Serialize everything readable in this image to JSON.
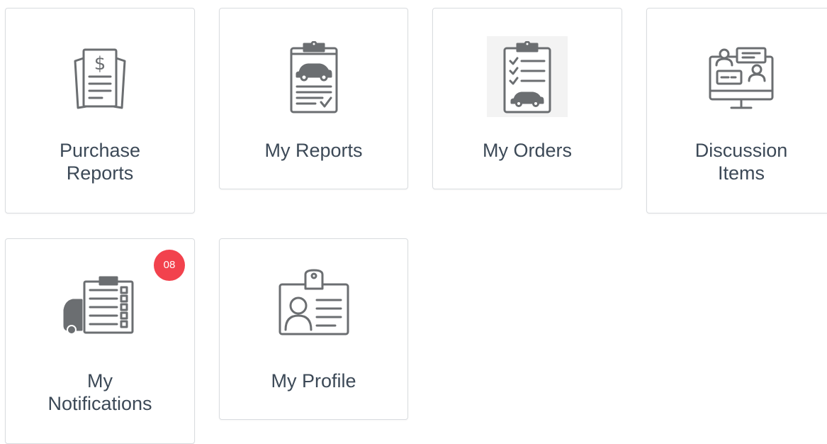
{
  "colors": {
    "icon_gray": "#6b6e71",
    "label_text": "#3c4957",
    "tile_border": "#d9dcdf",
    "badge_red": "#f2424d"
  },
  "tiles": [
    {
      "name": "purchase-reports",
      "label": "Purchase\nReports",
      "icon": "receipt-dollar-icon"
    },
    {
      "name": "my-reports",
      "label": "My Reports",
      "icon": "clipboard-car-report-icon"
    },
    {
      "name": "my-orders",
      "label": "My Orders",
      "icon": "clipboard-checklist-car-icon"
    },
    {
      "name": "discussion-items",
      "label": "Discussion\nItems",
      "icon": "monitor-chat-users-icon"
    },
    {
      "name": "my-notifications",
      "label": "My\nNotifications",
      "icon": "car-checklist-icon",
      "badge": "08"
    },
    {
      "name": "my-profile",
      "label": "My Profile",
      "icon": "id-badge-icon"
    }
  ]
}
